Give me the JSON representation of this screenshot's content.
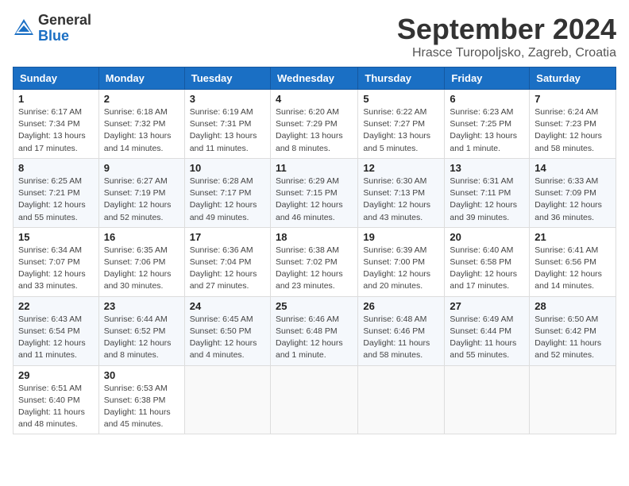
{
  "header": {
    "logo_general": "General",
    "logo_blue": "Blue",
    "month_title": "September 2024",
    "location": "Hrasce Turopoljsko, Zagreb, Croatia"
  },
  "calendar": {
    "headers": [
      "Sunday",
      "Monday",
      "Tuesday",
      "Wednesday",
      "Thursday",
      "Friday",
      "Saturday"
    ],
    "weeks": [
      [
        {
          "day": "1",
          "info": "Sunrise: 6:17 AM\nSunset: 7:34 PM\nDaylight: 13 hours\nand 17 minutes."
        },
        {
          "day": "2",
          "info": "Sunrise: 6:18 AM\nSunset: 7:32 PM\nDaylight: 13 hours\nand 14 minutes."
        },
        {
          "day": "3",
          "info": "Sunrise: 6:19 AM\nSunset: 7:31 PM\nDaylight: 13 hours\nand 11 minutes."
        },
        {
          "day": "4",
          "info": "Sunrise: 6:20 AM\nSunset: 7:29 PM\nDaylight: 13 hours\nand 8 minutes."
        },
        {
          "day": "5",
          "info": "Sunrise: 6:22 AM\nSunset: 7:27 PM\nDaylight: 13 hours\nand 5 minutes."
        },
        {
          "day": "6",
          "info": "Sunrise: 6:23 AM\nSunset: 7:25 PM\nDaylight: 13 hours\nand 1 minute."
        },
        {
          "day": "7",
          "info": "Sunrise: 6:24 AM\nSunset: 7:23 PM\nDaylight: 12 hours\nand 58 minutes."
        }
      ],
      [
        {
          "day": "8",
          "info": "Sunrise: 6:25 AM\nSunset: 7:21 PM\nDaylight: 12 hours\nand 55 minutes."
        },
        {
          "day": "9",
          "info": "Sunrise: 6:27 AM\nSunset: 7:19 PM\nDaylight: 12 hours\nand 52 minutes."
        },
        {
          "day": "10",
          "info": "Sunrise: 6:28 AM\nSunset: 7:17 PM\nDaylight: 12 hours\nand 49 minutes."
        },
        {
          "day": "11",
          "info": "Sunrise: 6:29 AM\nSunset: 7:15 PM\nDaylight: 12 hours\nand 46 minutes."
        },
        {
          "day": "12",
          "info": "Sunrise: 6:30 AM\nSunset: 7:13 PM\nDaylight: 12 hours\nand 43 minutes."
        },
        {
          "day": "13",
          "info": "Sunrise: 6:31 AM\nSunset: 7:11 PM\nDaylight: 12 hours\nand 39 minutes."
        },
        {
          "day": "14",
          "info": "Sunrise: 6:33 AM\nSunset: 7:09 PM\nDaylight: 12 hours\nand 36 minutes."
        }
      ],
      [
        {
          "day": "15",
          "info": "Sunrise: 6:34 AM\nSunset: 7:07 PM\nDaylight: 12 hours\nand 33 minutes."
        },
        {
          "day": "16",
          "info": "Sunrise: 6:35 AM\nSunset: 7:06 PM\nDaylight: 12 hours\nand 30 minutes."
        },
        {
          "day": "17",
          "info": "Sunrise: 6:36 AM\nSunset: 7:04 PM\nDaylight: 12 hours\nand 27 minutes."
        },
        {
          "day": "18",
          "info": "Sunrise: 6:38 AM\nSunset: 7:02 PM\nDaylight: 12 hours\nand 23 minutes."
        },
        {
          "day": "19",
          "info": "Sunrise: 6:39 AM\nSunset: 7:00 PM\nDaylight: 12 hours\nand 20 minutes."
        },
        {
          "day": "20",
          "info": "Sunrise: 6:40 AM\nSunset: 6:58 PM\nDaylight: 12 hours\nand 17 minutes."
        },
        {
          "day": "21",
          "info": "Sunrise: 6:41 AM\nSunset: 6:56 PM\nDaylight: 12 hours\nand 14 minutes."
        }
      ],
      [
        {
          "day": "22",
          "info": "Sunrise: 6:43 AM\nSunset: 6:54 PM\nDaylight: 12 hours\nand 11 minutes."
        },
        {
          "day": "23",
          "info": "Sunrise: 6:44 AM\nSunset: 6:52 PM\nDaylight: 12 hours\nand 8 minutes."
        },
        {
          "day": "24",
          "info": "Sunrise: 6:45 AM\nSunset: 6:50 PM\nDaylight: 12 hours\nand 4 minutes."
        },
        {
          "day": "25",
          "info": "Sunrise: 6:46 AM\nSunset: 6:48 PM\nDaylight: 12 hours\nand 1 minute."
        },
        {
          "day": "26",
          "info": "Sunrise: 6:48 AM\nSunset: 6:46 PM\nDaylight: 11 hours\nand 58 minutes."
        },
        {
          "day": "27",
          "info": "Sunrise: 6:49 AM\nSunset: 6:44 PM\nDaylight: 11 hours\nand 55 minutes."
        },
        {
          "day": "28",
          "info": "Sunrise: 6:50 AM\nSunset: 6:42 PM\nDaylight: 11 hours\nand 52 minutes."
        }
      ],
      [
        {
          "day": "29",
          "info": "Sunrise: 6:51 AM\nSunset: 6:40 PM\nDaylight: 11 hours\nand 48 minutes."
        },
        {
          "day": "30",
          "info": "Sunrise: 6:53 AM\nSunset: 6:38 PM\nDaylight: 11 hours\nand 45 minutes."
        },
        {
          "day": "",
          "info": ""
        },
        {
          "day": "",
          "info": ""
        },
        {
          "day": "",
          "info": ""
        },
        {
          "day": "",
          "info": ""
        },
        {
          "day": "",
          "info": ""
        }
      ]
    ]
  }
}
